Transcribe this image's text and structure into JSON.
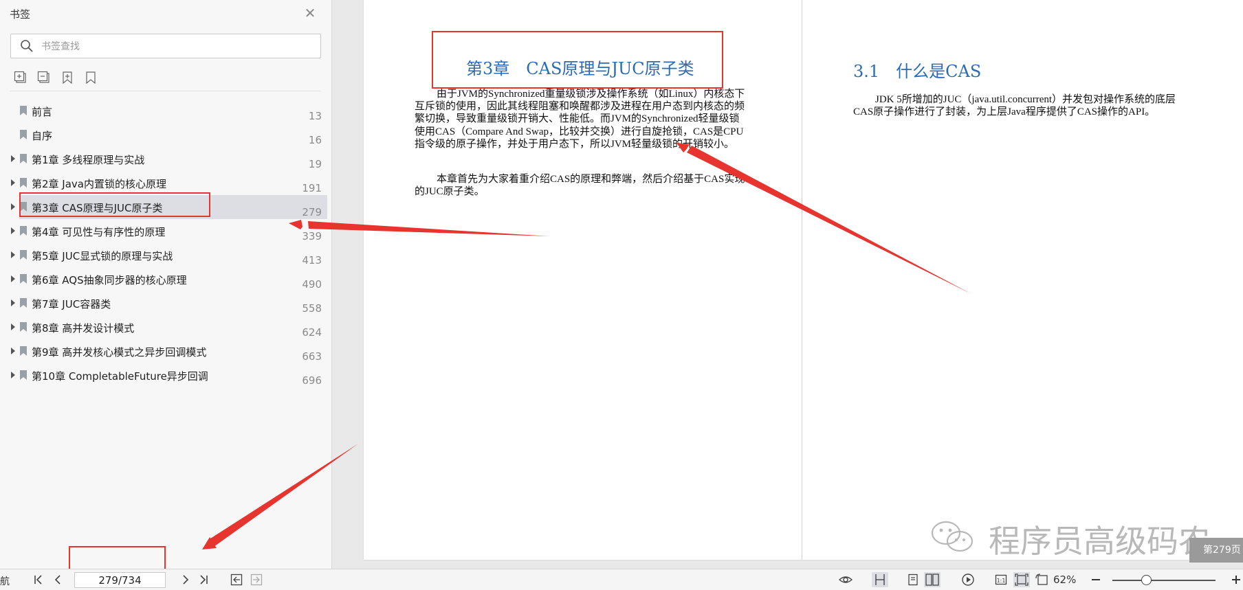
{
  "sidebar": {
    "title": "书签",
    "search_placeholder": "书签查找",
    "bookmarks": [
      {
        "label": "前言",
        "page": "13",
        "expandable": false
      },
      {
        "label": "自序",
        "page": "16",
        "expandable": false
      },
      {
        "label": "第1章 多线程原理与实战",
        "page": "19",
        "expandable": true
      },
      {
        "label": "第2章 Java内置锁的核心原理",
        "page": "191",
        "expandable": true
      },
      {
        "label": "第3章 CAS原理与JUC原子类",
        "page": "279",
        "expandable": true,
        "selected": true
      },
      {
        "label": "第4章 可见性与有序性的原理",
        "page": "339",
        "expandable": true
      },
      {
        "label": "第5章 JUC显式锁的原理与实战",
        "page": "413",
        "expandable": true
      },
      {
        "label": "第6章 AQS抽象同步器的核心原理",
        "page": "490",
        "expandable": true
      },
      {
        "label": "第7章 JUC容器类",
        "page": "558",
        "expandable": true
      },
      {
        "label": "第8章 高并发设计模式",
        "page": "624",
        "expandable": true
      },
      {
        "label": "第9章 高并发核心模式之异步回调模式",
        "page": "663",
        "expandable": true
      },
      {
        "label": "第10章 CompletableFuture异步回调",
        "page": "696",
        "expandable": true
      }
    ]
  },
  "document": {
    "chapter_title": "第3章　CAS原理与JUC原子类",
    "intro_paragraph": "由于JVM的Synchronized重量级锁涉及操作系统（如Linux）内核态下互斥锁的使用，因此其线程阻塞和唤醒都涉及进程在用户态到内核态的频繁切换，导致重量级锁开销大、性能低。而JVM的Synchronized轻量级锁使用CAS（Compare And Swap，比较并交换）进行自旋抢锁，CAS是CPU指令级的原子操作，并处于用户态下，所以JVM轻量级锁的开销较小。",
    "second_paragraph": "本章首先为大家着重介绍CAS的原理和弊端，然后介绍基于CAS实现的JUC原子类。",
    "section_title": "3.1　什么是CAS",
    "section_paragraph": "JDK 5所增加的JUC（java.util.concurrent）并发包对操作系统的底层CAS原子操作进行了封装，为上层Java程序提供了CAS操作的API。",
    "watermark": "程序员高级码农",
    "page_tip": "第279页"
  },
  "bottombar": {
    "nav_label": "航",
    "page_indicator": "279/734",
    "zoom_level": "62%"
  },
  "colors": {
    "heading_blue": "#2a6bb5",
    "annotation_red": "#e8342f",
    "selected_row": "#dcdee3"
  }
}
